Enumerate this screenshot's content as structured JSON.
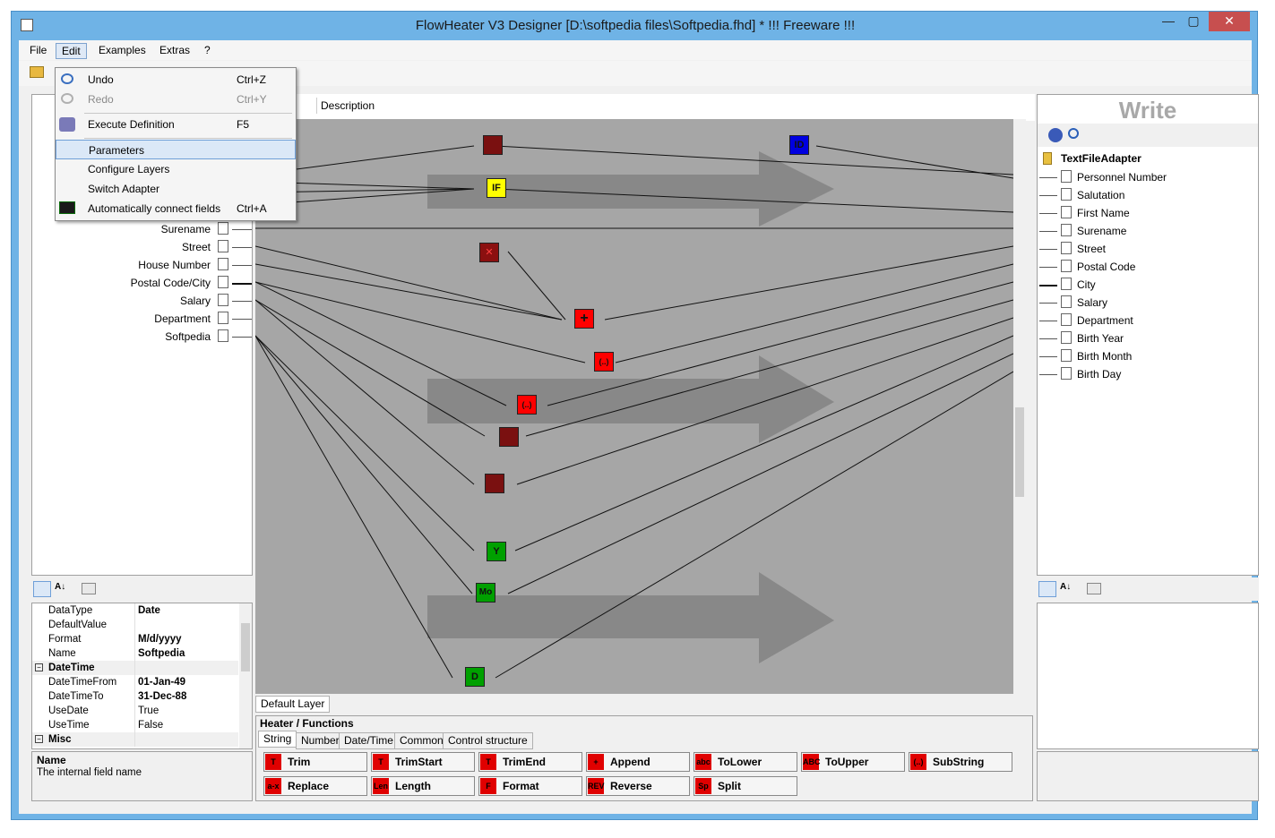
{
  "window": {
    "title": "FlowHeater V3 Designer [D:\\softpedia files\\Softpedia.fhd] * !!! Freeware !!!",
    "minimize": "—",
    "maximize": "▢",
    "close": "✕"
  },
  "menubar": {
    "items": [
      "File",
      "Edit",
      "Examples",
      "Extras",
      "?"
    ]
  },
  "edit_menu": {
    "items": [
      {
        "label": "Undo",
        "shortcut": "Ctrl+Z",
        "icon": "undo-icon"
      },
      {
        "label": "Redo",
        "shortcut": "Ctrl+Y",
        "icon": "redo-icon"
      },
      {
        "label": "Execute Definition",
        "shortcut": "F5",
        "icon": "execute-icon"
      },
      {
        "label": "Parameters",
        "shortcut": ""
      },
      {
        "label": "Configure Layers",
        "shortcut": ""
      },
      {
        "label": "Switch Adapter",
        "shortcut": ""
      },
      {
        "label": "Automatically connect fields",
        "shortcut": "Ctrl+A",
        "icon": "connect-fields-icon"
      }
    ]
  },
  "read_panel": {
    "fields": [
      "Surename",
      "Street",
      "House Number",
      "Postal Code/City",
      "Salary",
      "Department",
      "Softpedia"
    ]
  },
  "properties_left": {
    "rows": [
      {
        "name": "DataType",
        "value": "Date",
        "bold": true
      },
      {
        "name": "DefaultValue",
        "value": "",
        "bold": false
      },
      {
        "name": "Format",
        "value": "M/d/yyyy",
        "bold": true
      },
      {
        "name": "Name",
        "value": "Softpedia",
        "bold": true
      },
      {
        "name": "DateTime",
        "value": "",
        "category": true
      },
      {
        "name": "DateTimeFrom",
        "value": "01-Jan-49",
        "bold": true
      },
      {
        "name": "DateTimeTo",
        "value": "31-Dec-88",
        "bold": true
      },
      {
        "name": "UseDate",
        "value": "True",
        "bold": false
      },
      {
        "name": "UseTime",
        "value": "False",
        "bold": false
      },
      {
        "name": "Misc",
        "value": "",
        "category": true
      }
    ],
    "desc_title": "Name",
    "desc_text": "The internal field name"
  },
  "center": {
    "description_tab": "Description",
    "layer_tab": "Default Layer",
    "nodes": [
      {
        "label": "",
        "color": "#7a1010"
      },
      {
        "label": "ID",
        "color": "#0000e0"
      },
      {
        "label": "IF",
        "color": "#ffff00"
      },
      {
        "label": "✕",
        "color": "#8b1010"
      },
      {
        "label": "+",
        "color": "#ff0000"
      },
      {
        "label": "(..)",
        "color": "#ff0000"
      },
      {
        "label": "(..)",
        "color": "#ff0000"
      },
      {
        "label": "",
        "color": "#7a1010"
      },
      {
        "label": "",
        "color": "#7a1010"
      },
      {
        "label": "Y",
        "color": "#00a000"
      },
      {
        "label": "Mo",
        "color": "#00a000"
      },
      {
        "label": "D",
        "color": "#00a000"
      }
    ]
  },
  "heater": {
    "title": "Heater / Functions",
    "tabs": [
      "String",
      "Number",
      "Date/Time",
      "Common",
      "Control structure"
    ],
    "functions": [
      {
        "label": "Trim",
        "icon": "T"
      },
      {
        "label": "TrimStart",
        "icon": "T"
      },
      {
        "label": "TrimEnd",
        "icon": "T"
      },
      {
        "label": "Append",
        "icon": "+"
      },
      {
        "label": "ToLower",
        "icon": "abc"
      },
      {
        "label": "ToUpper",
        "icon": "ABC"
      },
      {
        "label": "SubString",
        "icon": "(..)"
      },
      {
        "label": "Replace",
        "icon": "a-x"
      },
      {
        "label": "Length",
        "icon": "Len"
      },
      {
        "label": "Format",
        "icon": "F"
      },
      {
        "label": "Reverse",
        "icon": "REV"
      },
      {
        "label": "Split",
        "icon": "Sp"
      }
    ]
  },
  "write_panel": {
    "title": "Write",
    "adapter": "TextFileAdapter",
    "fields": [
      "Personnel Number",
      "Salutation",
      "First Name",
      "Surename",
      "Street",
      "Postal Code",
      "City",
      "Salary",
      "Department",
      "Birth Year",
      "Birth Month",
      "Birth Day"
    ]
  }
}
